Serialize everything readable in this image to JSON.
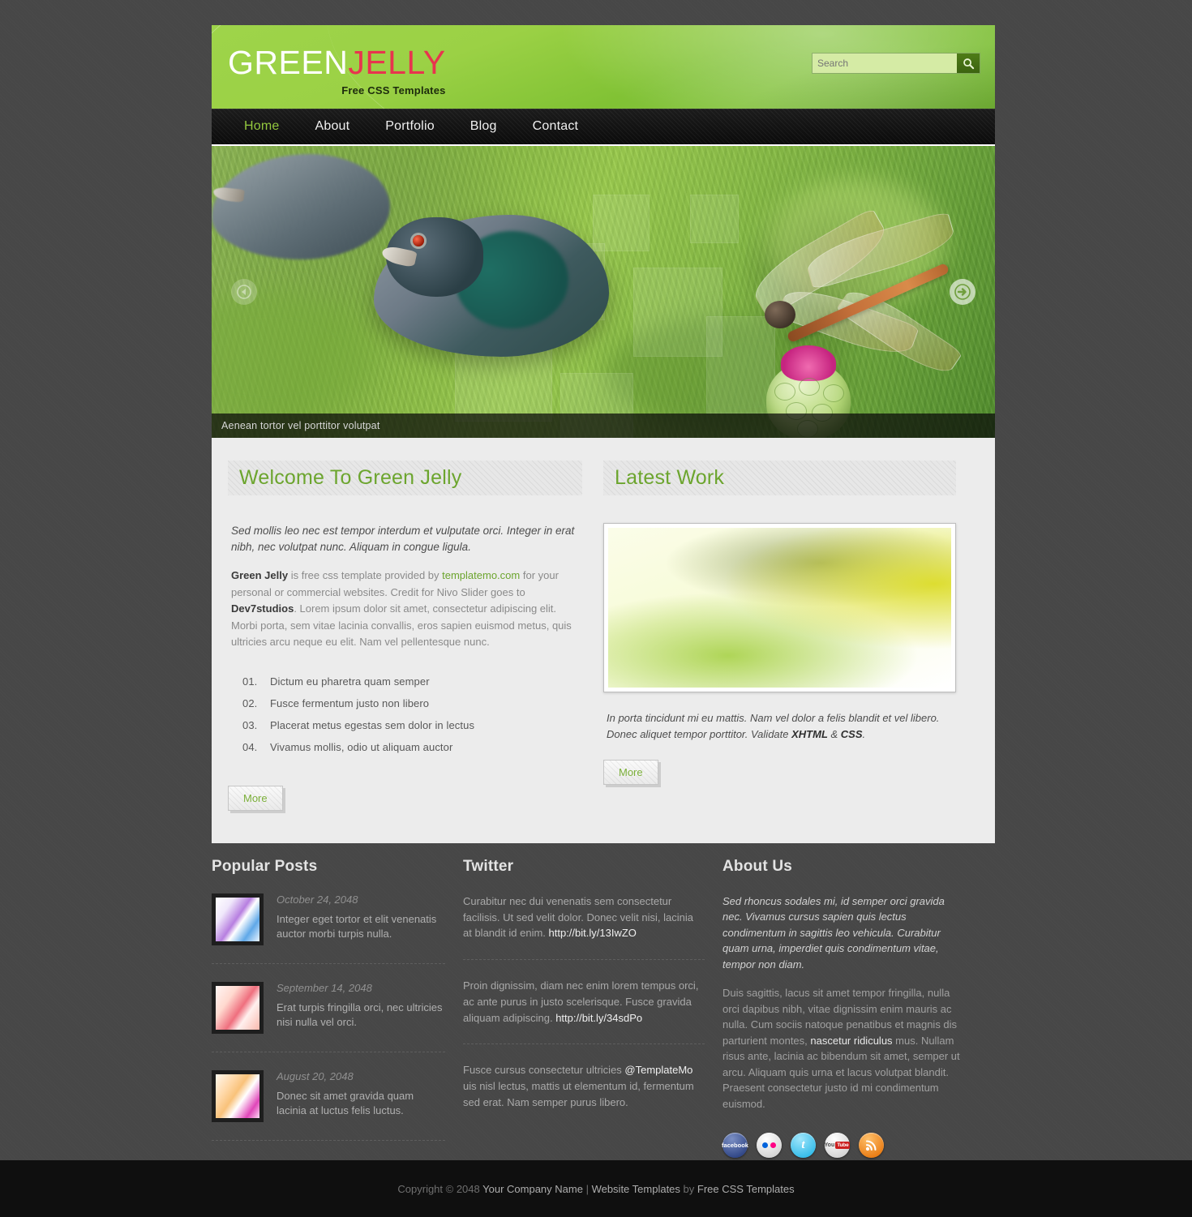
{
  "header": {
    "logo_primary": "GREEN",
    "logo_secondary": "JELLY",
    "tagline": "Free CSS Templates",
    "search_placeholder": "Search",
    "search_value": "",
    "search_icon": "search-icon",
    "accent_green": "#7cb03a",
    "accent_red": "#e8344e"
  },
  "nav": {
    "items": [
      {
        "label": "Home",
        "active": true
      },
      {
        "label": "About",
        "active": false
      },
      {
        "label": "Portfolio",
        "active": false
      },
      {
        "label": "Blog",
        "active": false
      },
      {
        "label": "Contact",
        "active": false
      }
    ]
  },
  "slider": {
    "caption": "Aenean tortor vel porttitor volutpat",
    "prev_icon": "arrow-left-icon",
    "next_icon": "arrow-right-icon"
  },
  "welcome": {
    "heading": "Welcome To Green Jelly",
    "intro": "Sed mollis leo nec est tempor interdum et vulputate orci. Integer in erat nibh, nec volutpat nunc. Aliquam in congue ligula.",
    "body_1": "Green Jelly",
    "body_2": " is free css template provided by ",
    "body_link": "templatemo.com",
    "body_3": " for your personal or commercial websites. Credit for Nivo Slider goes to ",
    "body_4": "Dev7studios",
    "body_5": ". Lorem ipsum dolor sit amet, consectetur adipiscing elit. Morbi porta, sem vitae lacinia convallis, eros sapien euismod metus, quis ultricies arcu neque eu elit. Nam vel pellentesque nunc.",
    "list": [
      {
        "num": "01.",
        "text": "Dictum eu pharetra quam semper"
      },
      {
        "num": "02.",
        "text": "Fusce fermentum justo non libero"
      },
      {
        "num": "03.",
        "text": "Placerat metus egestas sem dolor in lectus"
      },
      {
        "num": "04.",
        "text": "Vivamus mollis, odio ut aliquam auctor"
      }
    ],
    "more_label": "More"
  },
  "latest_work": {
    "heading": "Latest Work",
    "caption_1": "In porta tincidunt mi eu mattis. Nam vel dolor a felis blandit et vel libero. Donec aliquet tempor porttitor. Validate ",
    "caption_xhtml": "XHTML",
    "caption_amp": " & ",
    "caption_css": "CSS",
    "caption_end": ".",
    "more_label": "More"
  },
  "popular_posts": {
    "heading": "Popular Posts",
    "items": [
      {
        "date": "October 24, 2048",
        "text": "Integer eget tortor et elit venenatis auctor morbi turpis nulla."
      },
      {
        "date": "September 14, 2048",
        "text": "Erat turpis fringilla orci, nec ultricies nisi nulla vel orci."
      },
      {
        "date": "August 20, 2048",
        "text": "Donec sit amet gravida quam lacinia at luctus felis luctus."
      }
    ]
  },
  "twitter": {
    "heading": "Twitter",
    "items": [
      {
        "text": "Curabitur nec dui venenatis sem consectetur facilisis. Ut sed velit dolor. Donec velit nisi, lacinia at blandit id enim. ",
        "link": "http://bit.ly/13IwZO",
        "after": ""
      },
      {
        "text": "Proin dignissim, diam nec enim lorem tempus orci, ac ante purus in justo scelerisque. Fusce gravida aliquam adipiscing. ",
        "link": "http://bit.ly/34sdPo",
        "after": ""
      },
      {
        "text": "Fusce cursus consectetur ultricies ",
        "link": "@TemplateMo",
        "after": " uis nisl lectus, mattis ut elementum id, fermentum sed erat. Nam semper purus libero."
      }
    ]
  },
  "about_us": {
    "heading": "About Us",
    "lead": "Sed rhoncus sodales mi, id semper orci gravida nec. Vivamus cursus sapien quis lectus condimentum in sagittis leo vehicula. Curabitur quam urna, imperdiet quis condimentum vitae, tempor non diam.",
    "body_1": "Duis sagittis, lacus sit amet tempor fringilla, nulla orci dapibus nibh, vitae dignissim enim mauris ac nulla. Cum sociis natoque penatibus et magnis dis parturient montes, ",
    "body_link": "nascetur ridiculus",
    "body_2": " mus. Nullam risus ante, lacinia ac bibendum sit amet, semper ut arcu. Aliquam quis urna et lacus volutpat blandit. Praesent consectetur justo id mi condimentum euismod.",
    "socials": [
      {
        "name": "facebook-icon",
        "label": "facebook"
      },
      {
        "name": "flickr-icon",
        "label": ""
      },
      {
        "name": "twitter-icon",
        "label": "t"
      },
      {
        "name": "youtube-icon",
        "label": ""
      },
      {
        "name": "rss-icon",
        "label": ""
      }
    ]
  },
  "copyright": {
    "prefix": "Copyright © 2048 ",
    "company": "Your Company Name",
    "sep": " | ",
    "link1": "Website Templates",
    "mid": " by ",
    "link2": "Free CSS Templates"
  }
}
